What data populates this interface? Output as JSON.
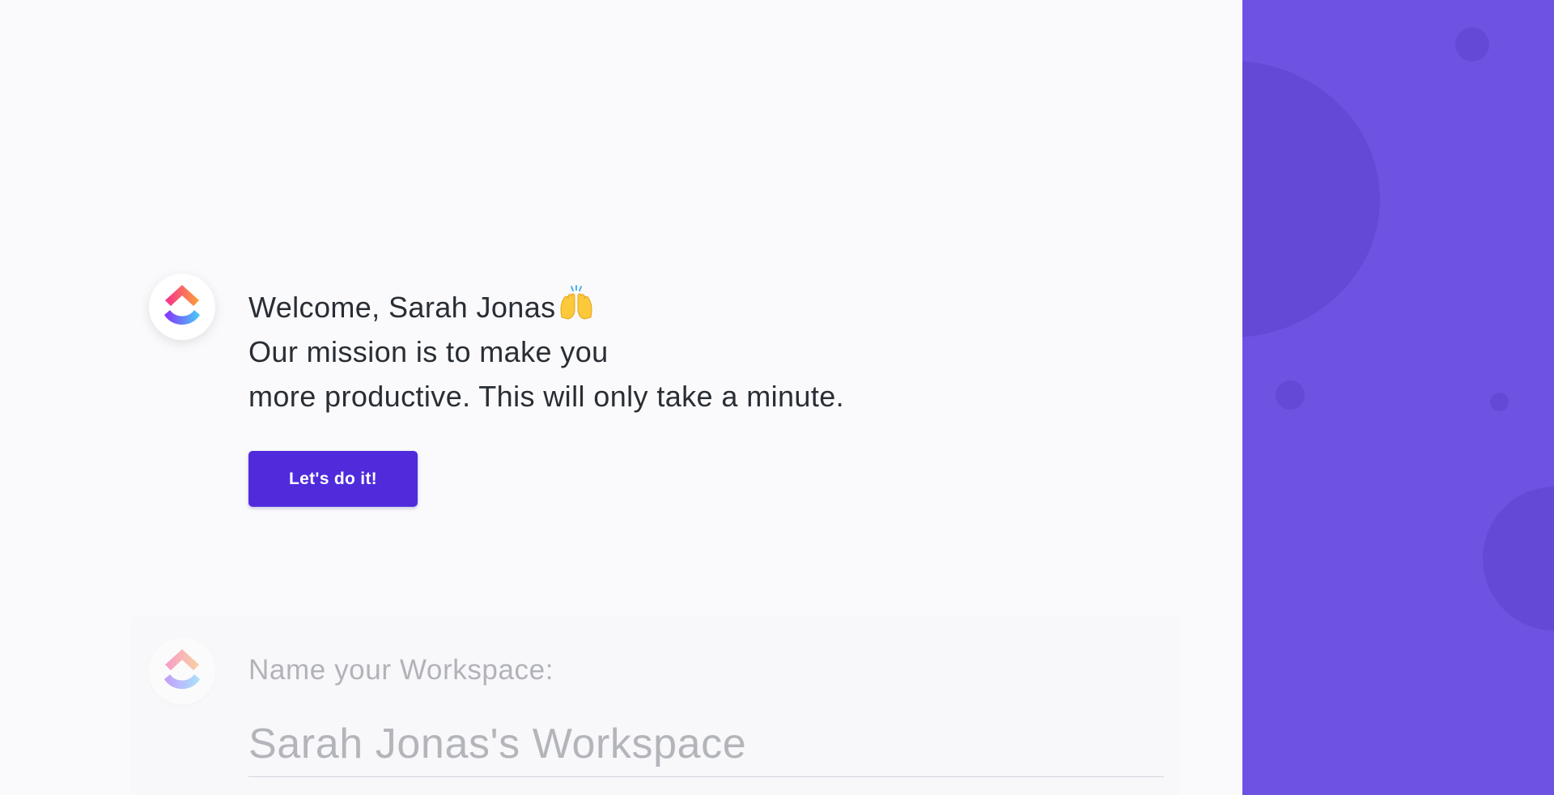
{
  "onboarding": {
    "greeting": "Welcome, Sarah Jonas",
    "greeting_emoji": "🙌",
    "mission_line1": "Our mission is to make you",
    "mission_line2": "more productive. This will only take a minute.",
    "cta_label": "Let's do it!"
  },
  "workspace_step": {
    "label": "Name your Workspace:",
    "placeholder": "Sarah Jonas's Workspace"
  },
  "brand": {
    "logo": "clickup-logo-icon",
    "accent_color": "#4f2bdc",
    "panel_color": "#6e52e2"
  }
}
